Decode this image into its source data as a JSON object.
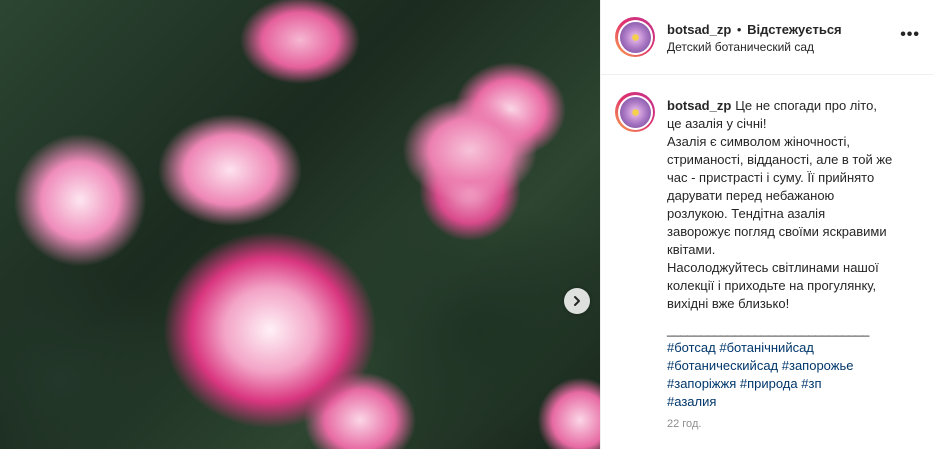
{
  "post": {
    "image_alt": "Азалія",
    "next_icon": "chevron-right-icon"
  },
  "header": {
    "username": "botsad_zp",
    "separator": "•",
    "follow_status": "Відстежується",
    "location": "Детский ботанический сад",
    "more_icon": "ellipsis-icon",
    "more_label": "•••"
  },
  "caption": {
    "username": "botsad_zp",
    "lines": [
      "Це не спогади про літо,",
      "це азалія у січні!",
      "Азалія є символом жіночності,",
      "стриманості, відданості, але в той же",
      "час - пристрасті і суму. Її прийнято",
      "дарувати перед небажаною",
      "розлукою. Тендітна азалія",
      "заворожує погляд своїми яскравими",
      "квітами.",
      "Насолоджуйтесь світлинами нашої",
      "колекції і приходьте на прогулянку,",
      "вихідні вже близько!"
    ],
    "divider": "______________________________",
    "hashtag_lines": [
      [
        "#ботсад",
        "#ботанічнийсад"
      ],
      [
        "#ботаническийсад",
        "#запорожье"
      ],
      [
        "#запоріжжя",
        "#природа",
        "#зп"
      ],
      [
        "#азалия"
      ]
    ]
  },
  "timestamp": "22 год.",
  "colors": {
    "link": "#00376b",
    "muted": "#8e8e8e",
    "text": "#262626"
  }
}
